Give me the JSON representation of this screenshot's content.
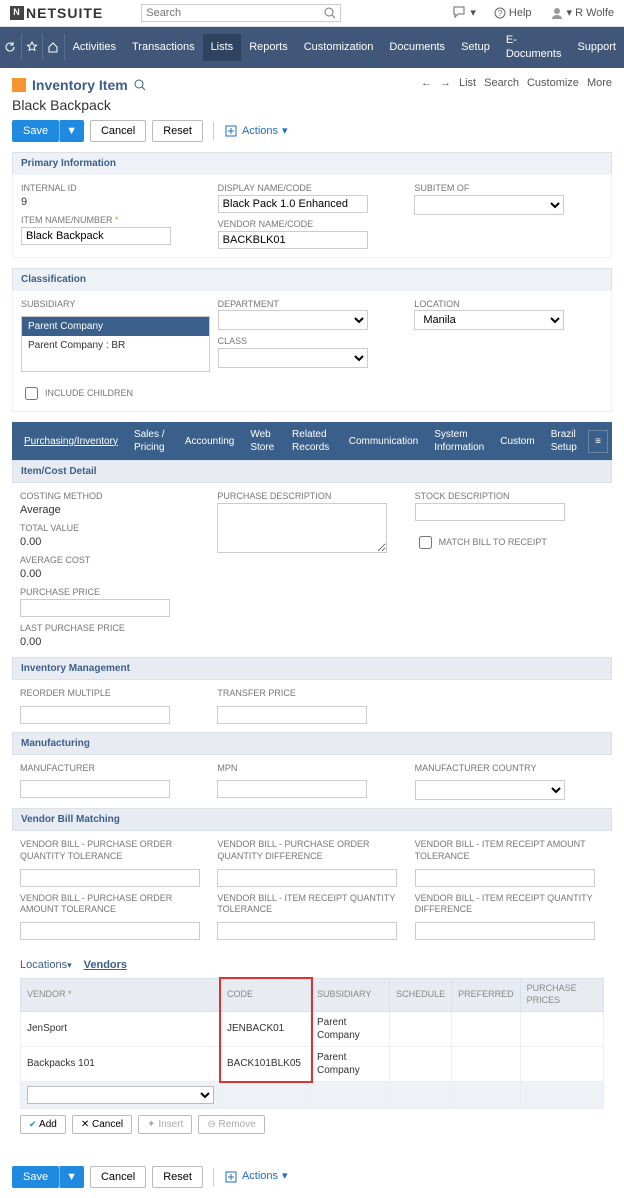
{
  "top": {
    "search_placeholder": "Search",
    "help": "Help",
    "user": "R Wolfe"
  },
  "nav": {
    "items": [
      "Activities",
      "Transactions",
      "Lists",
      "Reports",
      "Customization",
      "Documents",
      "Setup",
      "E-Documents",
      "Support"
    ],
    "active": 2
  },
  "head": {
    "title": "Inventory Item",
    "subtitle": "Black Backpack",
    "save": "Save",
    "cancel": "Cancel",
    "reset": "Reset",
    "actions": "Actions",
    "right": [
      "List",
      "Search",
      "Customize",
      "More"
    ]
  },
  "primary": {
    "title": "Primary Information",
    "internal_id_lbl": "INTERNAL ID",
    "internal_id": "9",
    "item_name_lbl": "ITEM NAME/NUMBER",
    "item_name": "Black Backpack",
    "display_lbl": "DISPLAY NAME/CODE",
    "display": "Black Pack 1.0 Enhanced",
    "vendor_lbl": "VENDOR NAME/CODE",
    "vendor": "BACKBLK01",
    "subitem_lbl": "SUBITEM OF"
  },
  "classif": {
    "title": "Classification",
    "subsidiary_lbl": "SUBSIDIARY",
    "subs": [
      "Parent Company",
      "Parent Company : BR"
    ],
    "dept_lbl": "DEPARTMENT",
    "class_lbl": "CLASS",
    "loc_lbl": "LOCATION",
    "loc": "Manila",
    "include": "INCLUDE CHILDREN"
  },
  "tabs": [
    "Purchasing/Inventory",
    "Sales / Pricing",
    "Accounting",
    "Web Store",
    "Related Records",
    "Communication",
    "System Information",
    "Custom",
    "Brazil Setup"
  ],
  "itemcost": {
    "title": "Item/Cost Detail",
    "costing_lbl": "COSTING METHOD",
    "costing": "Average",
    "total_lbl": "TOTAL VALUE",
    "total": "0.00",
    "avg_lbl": "AVERAGE COST",
    "avg": "0.00",
    "pp_lbl": "PURCHASE PRICE",
    "lpp_lbl": "LAST PURCHASE PRICE",
    "lpp": "0.00",
    "pd_lbl": "PURCHASE DESCRIPTION",
    "sd_lbl": "STOCK DESCRIPTION",
    "match": "MATCH BILL TO RECEIPT"
  },
  "inv": {
    "title": "Inventory Management",
    "reorder_lbl": "REORDER MULTIPLE",
    "transfer_lbl": "TRANSFER PRICE"
  },
  "mfg": {
    "title": "Manufacturing",
    "mfr_lbl": "MANUFACTURER",
    "mpn_lbl": "MPN",
    "country_lbl": "MANUFACTURER COUNTRY"
  },
  "vbm": {
    "title": "Vendor Bill Matching",
    "f": [
      "VENDOR BILL - PURCHASE ORDER QUANTITY TOLERANCE",
      "VENDOR BILL - PURCHASE ORDER QUANTITY DIFFERENCE",
      "VENDOR BILL - ITEM RECEIPT AMOUNT TOLERANCE",
      "VENDOR BILL - PURCHASE ORDER AMOUNT TOLERANCE",
      "VENDOR BILL - ITEM RECEIPT QUANTITY TOLERANCE",
      "VENDOR BILL - ITEM RECEIPT QUANTITY DIFFERENCE"
    ]
  },
  "subtabs": {
    "locations": "Locations",
    "vendors": "Vendors"
  },
  "grid": {
    "cols": [
      "VENDOR",
      "CODE",
      "SUBSIDIARY",
      "SCHEDULE",
      "PREFERRED",
      "PURCHASE PRICES"
    ],
    "rows": [
      {
        "vendor": "JenSport",
        "code": "JENBACK01",
        "sub": "Parent Company"
      },
      {
        "vendor": "Backpacks 101",
        "code": "BACK101BLK05",
        "sub": "Parent Company"
      }
    ],
    "add": "Add",
    "cancel": "Cancel",
    "insert": "Insert",
    "remove": "Remove"
  }
}
